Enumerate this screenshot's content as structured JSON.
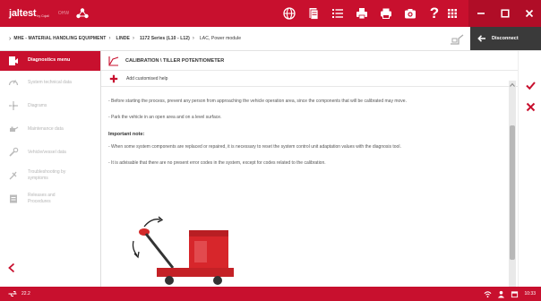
{
  "app": {
    "logo_text": "jaltest",
    "logo_subtitle": "by Cojali",
    "logo_extension": "OHW",
    "brand_color": "#c8102e"
  },
  "toolbar": {
    "icons": [
      "globe-icon",
      "document-icon",
      "list-icon",
      "printer-stack-icon",
      "print-icon",
      "camera-icon",
      "help-icon"
    ],
    "help_label": "?"
  },
  "breadcrumb": {
    "items": [
      "MHE - MATERIAL HANDLING EQUIPMENT",
      "LINDE",
      "1172 Series (L10 - L12)",
      "LAC, Power module"
    ],
    "separator": "›"
  },
  "disconnect": {
    "label": "Disconnect"
  },
  "sidebar": {
    "items": [
      {
        "label": "Diagnostics menu",
        "icon": "diagnostics-icon",
        "active": true
      },
      {
        "label": "System technical data",
        "icon": "gauge-icon",
        "active": false
      },
      {
        "label": "Diagrams",
        "icon": "diagram-icon",
        "active": false
      },
      {
        "label": "Maintenance data",
        "icon": "oil-can-icon",
        "active": false
      },
      {
        "label": "Vehicle/vessel data",
        "icon": "wrench-icon",
        "active": false
      },
      {
        "label": "Troubleshooting by symptoms",
        "icon": "troubleshooting-icon",
        "active": false
      },
      {
        "label": "Releases and Procedures",
        "icon": "releases-icon",
        "active": false
      }
    ]
  },
  "main": {
    "title": "CALIBRATION \\ TILLER POTENTIOMETER",
    "add_help_label": "Add customised help",
    "paragraphs_before": [
      "- Before starting the process, prevent any person from approaching the vehicle operation area, since the components that will be calibrated may move.",
      "- Park the vehicle in an open area and on a level surface."
    ],
    "note_heading": "Important note:",
    "paragraphs_after": [
      "- When some system components are replaced or repaired, it is necessary to reset the system control unit adaptation values with the diagnosis tool.",
      "- It is advisable that there are no present error codes in the system, except for codes related to the calibration."
    ]
  },
  "actions": {
    "confirm_icon": "check-icon",
    "cancel_icon": "close-icon"
  },
  "status": {
    "voltage": "22.2",
    "time": "10:33"
  }
}
